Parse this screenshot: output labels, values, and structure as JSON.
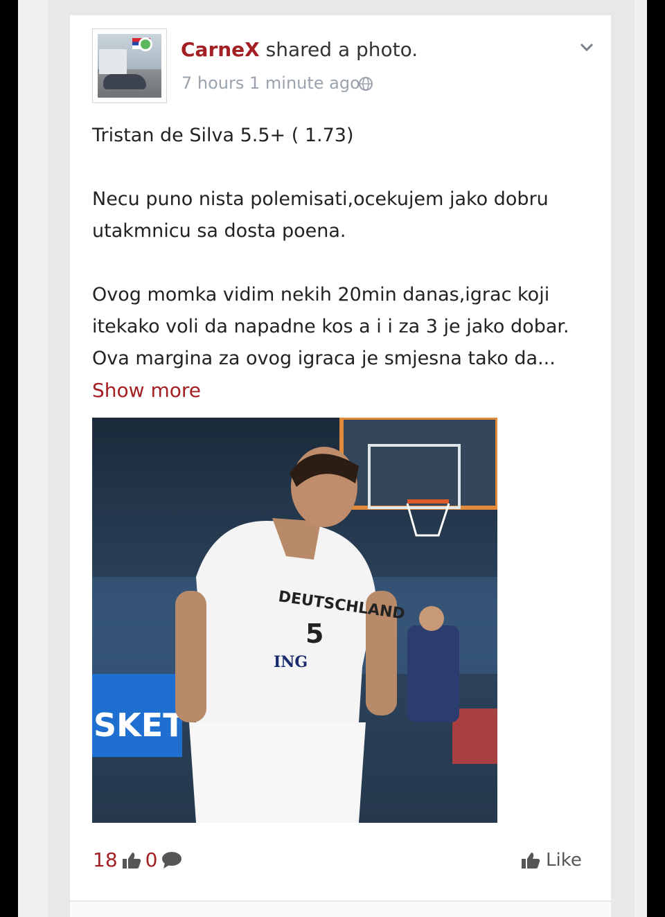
{
  "post": {
    "author": "CarneX",
    "action": " shared a photo.",
    "timestamp": "7 hours 1 minute ago",
    "paragraphs": [
      "Tristan de Silva 5.5+ ( 1.73)",
      "Necu puno nista polemisati,ocekujem jako dobru utakmnicu sa dosta poena.",
      "Ovog momka vidim nekih 20min danas,igrac koji itekako voli da napadne kos a i i za 3 je jako dobar. Ova margina za ovog igraca je smjesna tako da..."
    ],
    "show_more": "Show more",
    "photo": {
      "jersey_text": "DEUTSCHLAND",
      "jersey_number": "5",
      "sponsor": "ING",
      "banner": "SKET"
    }
  },
  "stats": {
    "likes": "18",
    "comments": "0"
  },
  "actions": {
    "like_label": "Like"
  },
  "colors": {
    "accent": "#a31f24",
    "online": "#5cb85c",
    "meta": "#9aa3ad"
  },
  "icons": {
    "globe": "globe-icon",
    "chevron": "chevron-down-icon",
    "thumb": "thumbs-up-icon",
    "comment": "comment-icon"
  }
}
